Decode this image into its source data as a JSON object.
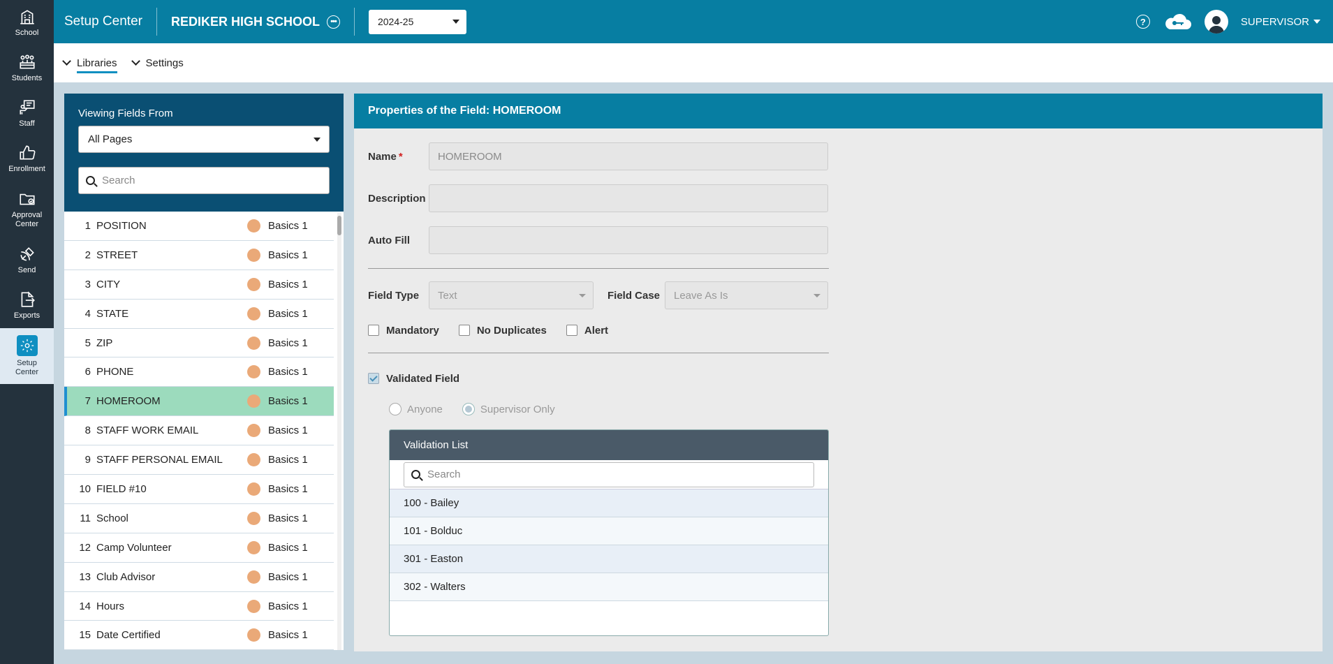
{
  "rail": {
    "items": [
      {
        "label": "School",
        "icon": "building-icon"
      },
      {
        "label": "Students",
        "icon": "students-icon"
      },
      {
        "label": "Staff",
        "icon": "staff-icon"
      },
      {
        "label": "Enrollment",
        "icon": "thumbs-up-icon"
      },
      {
        "label": "Approval\nCenter",
        "icon": "folder-check-icon"
      },
      {
        "label": "Send",
        "icon": "satellite-icon"
      },
      {
        "label": "Exports",
        "icon": "export-icon"
      },
      {
        "label": "Setup\nCenter",
        "icon": "gear-icon"
      }
    ]
  },
  "topbar": {
    "app_title": "Setup Center",
    "school": "REDIKER HIGH SCHOOL",
    "year": "2024-25",
    "user": "SUPERVISOR"
  },
  "subnav": {
    "libraries": "Libraries",
    "settings": "Settings"
  },
  "left_panel": {
    "title": "Viewing Fields From",
    "pages_select": "All Pages",
    "search_placeholder": "Search",
    "rows": [
      {
        "num": "1",
        "name": "POSITION",
        "page": "Basics 1"
      },
      {
        "num": "2",
        "name": "STREET",
        "page": "Basics 1"
      },
      {
        "num": "3",
        "name": "CITY",
        "page": "Basics 1"
      },
      {
        "num": "4",
        "name": "STATE",
        "page": "Basics 1"
      },
      {
        "num": "5",
        "name": "ZIP",
        "page": "Basics 1"
      },
      {
        "num": "6",
        "name": "PHONE",
        "page": "Basics 1"
      },
      {
        "num": "7",
        "name": "HOMEROOM",
        "page": "Basics 1"
      },
      {
        "num": "8",
        "name": "STAFF WORK EMAIL",
        "page": "Basics 1"
      },
      {
        "num": "9",
        "name": "STAFF PERSONAL EMAIL",
        "page": "Basics 1"
      },
      {
        "num": "10",
        "name": "FIELD #10",
        "page": "Basics 1"
      },
      {
        "num": "11",
        "name": "School",
        "page": "Basics 1"
      },
      {
        "num": "12",
        "name": "Camp Volunteer",
        "page": "Basics 1"
      },
      {
        "num": "13",
        "name": "Club Advisor",
        "page": "Basics 1"
      },
      {
        "num": "14",
        "name": "Hours",
        "page": "Basics 1"
      },
      {
        "num": "15",
        "name": "Date Certified",
        "page": "Basics 1"
      }
    ]
  },
  "properties": {
    "header": "Properties of the Field: HOMEROOM",
    "name_label": "Name",
    "required_mark": "*",
    "name_value": "HOMEROOM",
    "description_label": "Description",
    "description_value": "",
    "autofill_label": "Auto Fill",
    "autofill_value": "",
    "field_type_label": "Field Type",
    "field_type_value": "Text",
    "field_case_label": "Field Case",
    "field_case_value": "Leave As Is",
    "mandatory_label": "Mandatory",
    "no_duplicates_label": "No Duplicates",
    "alert_label": "Alert",
    "validated_label": "Validated Field",
    "anyone_label": "Anyone",
    "supervisor_only_label": "Supervisor Only",
    "validation_list": {
      "title": "Validation List",
      "search_placeholder": "Search",
      "items": [
        "100 - Bailey",
        "101 - Bolduc",
        "301 - Easton",
        "302 - Walters"
      ]
    }
  }
}
